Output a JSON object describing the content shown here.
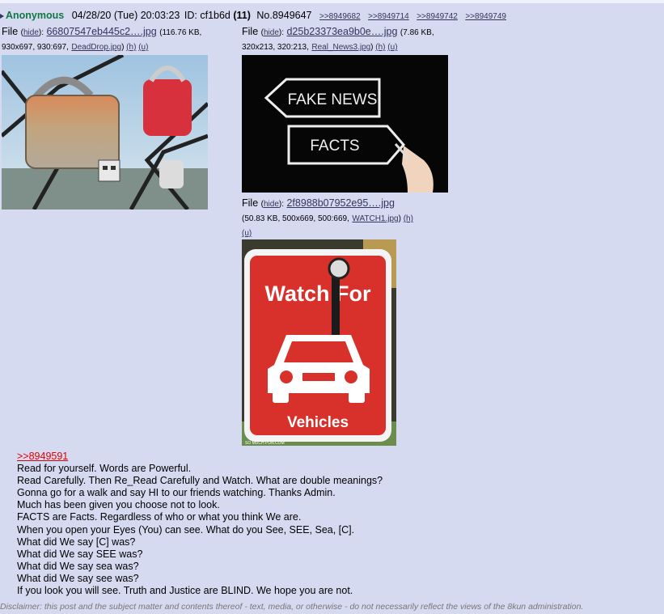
{
  "post": {
    "name": "Anonymous",
    "date": "04/28/20 (Tue) 20:03:23",
    "id_label": "ID:",
    "id_value": "cf1b6d",
    "id_count": "(11)",
    "post_number": "No.8949647",
    "backlinks": [
      ">>8949682",
      ">>8949714",
      ">>8949742",
      ">>8949749"
    ]
  },
  "files": [
    {
      "label": "File",
      "hide": "hide",
      "filename": "66807547eb445c2….jpg",
      "meta": "(116.76 KB, 930x697, 930:697,",
      "orig": "DeadDrop.jpg",
      "h": "(h)",
      "u": "(u)"
    },
    {
      "label": "File",
      "hide": "hide",
      "filename": "d25b23373ea9b0e….jpg",
      "meta": "(7.86 KB, 320x213, 320:213,",
      "orig": "Real_News3.jpg",
      "h": "(h)",
      "u": "(u)",
      "image_text": [
        "FAKE NEWS",
        "FACTS"
      ]
    },
    {
      "label": "File",
      "hide": "hide",
      "filename": "2f8988b07952e95….jpg",
      "meta": "(50.83 KB, 500x669, 500:669,",
      "orig": "WATCH1.jpg",
      "h": "(h)",
      "u": "(u)",
      "image_text": [
        "Watch For",
        "Vehicles",
        "SO MUCH PUN.COM"
      ]
    }
  ],
  "body": {
    "quote_link": ">>8949591",
    "lines": [
      "Read for yourself. Words are Powerful.",
      "Read Carefully. Then Re_Read Carefully and Watch. What are double meanings?",
      "Gonna go for a walk and say HI to our friends watching. Thanks Admin.",
      "Much has been given you choose not to look.",
      "FACTS are Facts. Regardless of who or what you think We are.",
      "When you open your Eyes (You) can see. What do you See, SEE, Sea, [C].",
      "What did We say [C] was?",
      "What did We say SEE was?",
      "What did We say sea was?",
      "What did We say see was?",
      "If you look you will see. Truth and Justice are BLIND. We hope you are not."
    ]
  },
  "disclaimer": "Disclaimer: this post and the subject matter and contents thereof - text, media, or otherwise - do not necessarily reflect the views of the 8kun administration.",
  "colors": {
    "post_bg": "#d6daf0",
    "name": "#117743",
    "link": "#34345c",
    "quote": "#dd0000"
  }
}
